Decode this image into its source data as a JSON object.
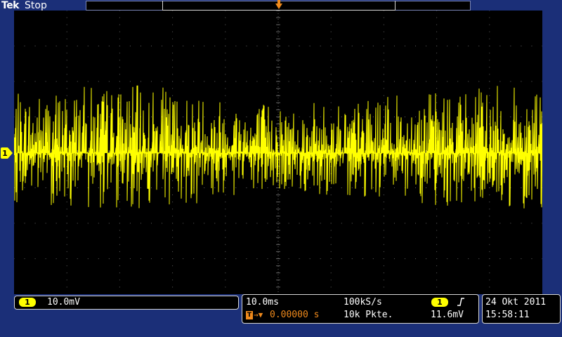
{
  "header": {
    "brand": "Tek",
    "run_state": "Stop"
  },
  "trigger": {
    "marker_label": "T"
  },
  "channel": {
    "number": "1",
    "color": "#ffff00"
  },
  "display": {
    "background": "#1b2f78",
    "grid_color": "#606060",
    "trace_color": "#ffff00",
    "trigger_color": "#f08a1c"
  },
  "channel_panel": {
    "channel": "1",
    "volts_per_div": "10.0mV"
  },
  "timebase_panel": {
    "time_per_div": "10.0ms",
    "sample_rate": "100kS/s",
    "trigger_position_label": "T",
    "trigger_position": "0.00000 s",
    "record_length": "10k Pkte.",
    "trigger_channel": "1",
    "trigger_slope_icon": "rising-edge-icon",
    "trigger_level": "11.6mV"
  },
  "datetime_panel": {
    "date": "24 Okt 2011",
    "time": "15:58:11"
  }
}
